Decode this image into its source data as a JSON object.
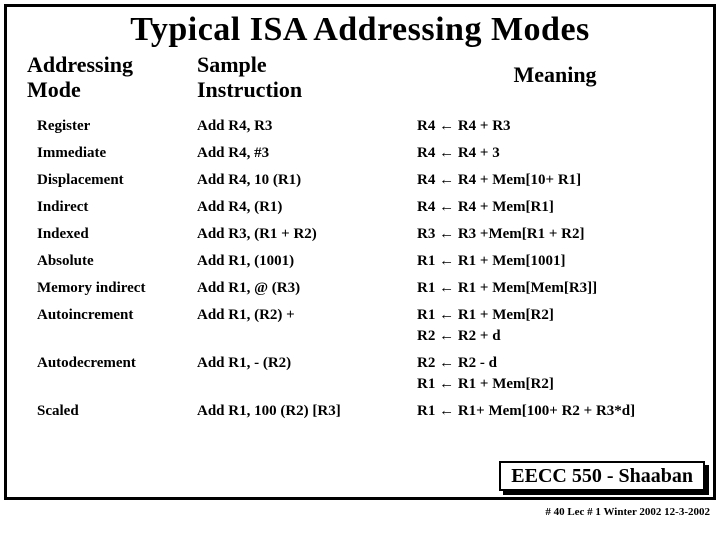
{
  "title": "Typical ISA Addressing Modes",
  "headers": {
    "mode": "Addressing\nMode",
    "sample": "Sample\nInstruction",
    "meaning": "Meaning"
  },
  "rows": [
    {
      "mode": "Register",
      "sample": "Add R4, R3",
      "meaning": "R4 ← R4 + R3"
    },
    {
      "mode": "Immediate",
      "sample": "Add R4, #3",
      "meaning": "R4 ← R4 + 3"
    },
    {
      "mode": "Displacement",
      "sample": "Add R4, 10 (R1)",
      "meaning": "R4 ← R4 + Mem[10+ R1]"
    },
    {
      "mode": "Indirect",
      "sample": "Add R4, (R1)",
      "meaning": "R4 ← R4 + Mem[R1]"
    },
    {
      "mode": "Indexed",
      "sample": "Add R3, (R1 + R2)",
      "meaning": "R3 ← R3 +Mem[R1 + R2]"
    },
    {
      "mode": "Absolute",
      "sample": "Add R1, (1001)",
      "meaning": "R1 ← R1 + Mem[1001]"
    },
    {
      "mode": "Memory indirect",
      "sample": "Add R1, @ (R3)",
      "meaning": "R1 ← R1 + Mem[Mem[R3]]"
    },
    {
      "mode": "Autoincrement",
      "sample": "Add R1, (R2) +",
      "meaning": "R1 ← R1 +  Mem[R2]",
      "extra": "R2 ← R2 + d"
    },
    {
      "mode": "Autodecrement",
      "sample": "Add R1, - (R2)",
      "meaning": "R2 ← R2 - d",
      "extra": "R1 ← R1 + Mem[R2]"
    },
    {
      "mode": "Scaled",
      "sample": "Add R1, 100 (R2) [R3]",
      "meaning": "R1 ← R1+ Mem[100+ R2 + R3*d]"
    }
  ],
  "footer": {
    "badge": "EECC 550 - Shaaban",
    "line": "# 40   Lec # 1 Winter 2002   12-3-2002"
  }
}
